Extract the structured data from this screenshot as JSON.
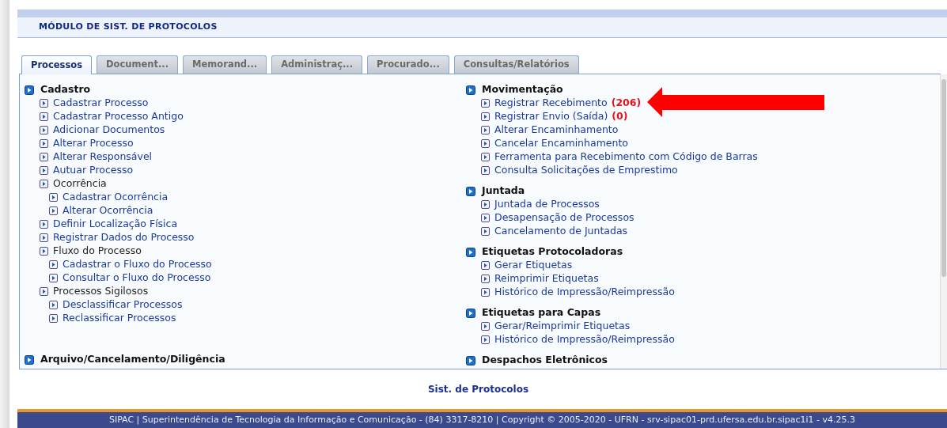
{
  "module_title": "MÓDULO DE SIST. DE PROTOCOLOS",
  "tabs": [
    {
      "label": "Processos",
      "selected": true
    },
    {
      "label": "Document...",
      "selected": false
    },
    {
      "label": "Memorand...",
      "selected": false
    },
    {
      "label": "Administraç...",
      "selected": false
    },
    {
      "label": "Procurado...",
      "selected": false
    },
    {
      "label": "Consultas/Relatórios",
      "selected": false
    }
  ],
  "columns": [
    {
      "sections": [
        {
          "title": "Cadastro",
          "items": [
            {
              "kind": "link",
              "label": "Cadastrar Processo"
            },
            {
              "kind": "link",
              "label": "Cadastrar Processo Antigo"
            },
            {
              "kind": "link",
              "label": "Adicionar Documentos"
            },
            {
              "kind": "link",
              "label": "Alterar Processo"
            },
            {
              "kind": "link",
              "label": "Alterar Responsável"
            },
            {
              "kind": "link",
              "label": "Autuar Processo"
            },
            {
              "kind": "group",
              "label": "Ocorrência",
              "children": [
                {
                  "kind": "link",
                  "label": "Cadastrar Ocorrência"
                },
                {
                  "kind": "link",
                  "label": "Alterar Ocorrência"
                }
              ]
            },
            {
              "kind": "link",
              "label": "Definir Localização Física"
            },
            {
              "kind": "link",
              "label": "Registrar Dados do Processo"
            },
            {
              "kind": "group",
              "label": "Fluxo do Processo",
              "children": [
                {
                  "kind": "link",
                  "label": "Cadastrar o Fluxo do Processo"
                },
                {
                  "kind": "link",
                  "label": "Consultar o Fluxo do Processo"
                }
              ]
            },
            {
              "kind": "group",
              "label": "Processos Sigilosos",
              "children": [
                {
                  "kind": "link",
                  "label": "Desclassificar Processos"
                },
                {
                  "kind": "link",
                  "label": "Reclassificar Processos"
                }
              ]
            }
          ]
        },
        {
          "title": "Arquivo/Cancelamento/Diligência"
        }
      ]
    },
    {
      "sections": [
        {
          "title": "Movimentação",
          "items": [
            {
              "kind": "link",
              "label": "Registrar Recebimento",
              "count": "(206)"
            },
            {
              "kind": "link",
              "label": "Registrar Envio (Saída)",
              "count": "(0)"
            },
            {
              "kind": "link",
              "label": "Alterar Encaminhamento"
            },
            {
              "kind": "link",
              "label": "Cancelar Encaminhamento"
            },
            {
              "kind": "link",
              "label": "Ferramenta para Recebimento com Código de Barras"
            },
            {
              "kind": "link",
              "label": "Consulta Solicitações de Emprestimo"
            }
          ]
        },
        {
          "title": "Juntada",
          "items": [
            {
              "kind": "link",
              "label": "Juntada de Processos"
            },
            {
              "kind": "link",
              "label": "Desapensação de Processos"
            },
            {
              "kind": "link",
              "label": "Cancelamento de Juntadas"
            }
          ]
        },
        {
          "title": "Etiquetas Protocoladoras",
          "items": [
            {
              "kind": "link",
              "label": "Gerar Etiquetas"
            },
            {
              "kind": "link",
              "label": "Reimprimir Etiquetas"
            },
            {
              "kind": "link",
              "label": "Histórico de Impressão/Reimpressão"
            }
          ]
        },
        {
          "title": "Etiquetas para Capas",
          "items": [
            {
              "kind": "link",
              "label": "Gerar/Reimprimir Etiquetas"
            },
            {
              "kind": "link",
              "label": "Histórico de Impressão/Reimpressão"
            }
          ]
        },
        {
          "title": "Despachos Eletrônicos"
        }
      ]
    }
  ],
  "footer_link": "Sist. de Protocolos",
  "status_bar": "SIPAC | Superintendência de Tecnologia da Informação e Comunicação - (84) 3317-8210 | Copyright © 2005-2020 - UFRN - srv-sipac01-prd.ufersa.edu.br.sipac1i1 - v4.25.3"
}
